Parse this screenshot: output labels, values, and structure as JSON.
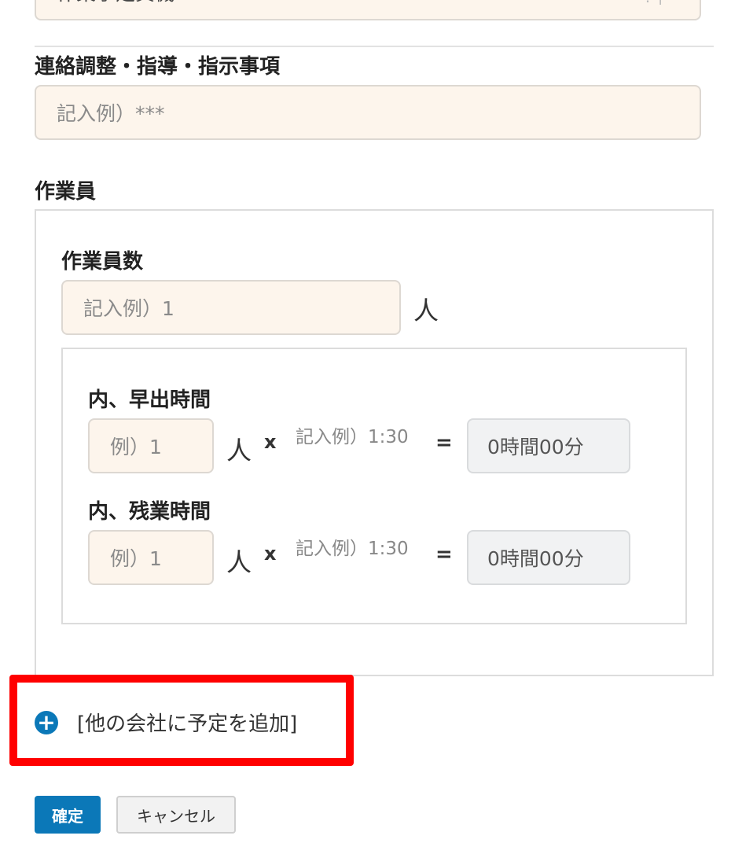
{
  "top_field": {
    "value": "作業予定資機"
  },
  "liaison": {
    "label": "連絡調整・指導・指示事項",
    "placeholder": "記入例）***"
  },
  "workers": {
    "section_label": "作業員",
    "count_label": "作業員数",
    "count_placeholder": "記入例）1",
    "unit": "人",
    "early": {
      "label": "内、早出時間",
      "people_placeholder": "例）1",
      "unit": "人",
      "times": "x",
      "time_hint": "記入例）1:30",
      "equals": "=",
      "result": "0時間00分"
    },
    "overtime": {
      "label": "内、残業時間",
      "people_placeholder": "例）1",
      "unit": "人",
      "times": "x",
      "time_hint": "記入例）1:30",
      "equals": "=",
      "result": "0時間00分"
    }
  },
  "add_company": {
    "label": "[他の会社に予定を追加]",
    "icon": "plus-circle-icon"
  },
  "actions": {
    "confirm": "確定",
    "cancel": "キャンセル"
  },
  "colors": {
    "accent": "#0b78b8",
    "highlight": "#ff0000",
    "field_bg": "#fdf5ec"
  }
}
